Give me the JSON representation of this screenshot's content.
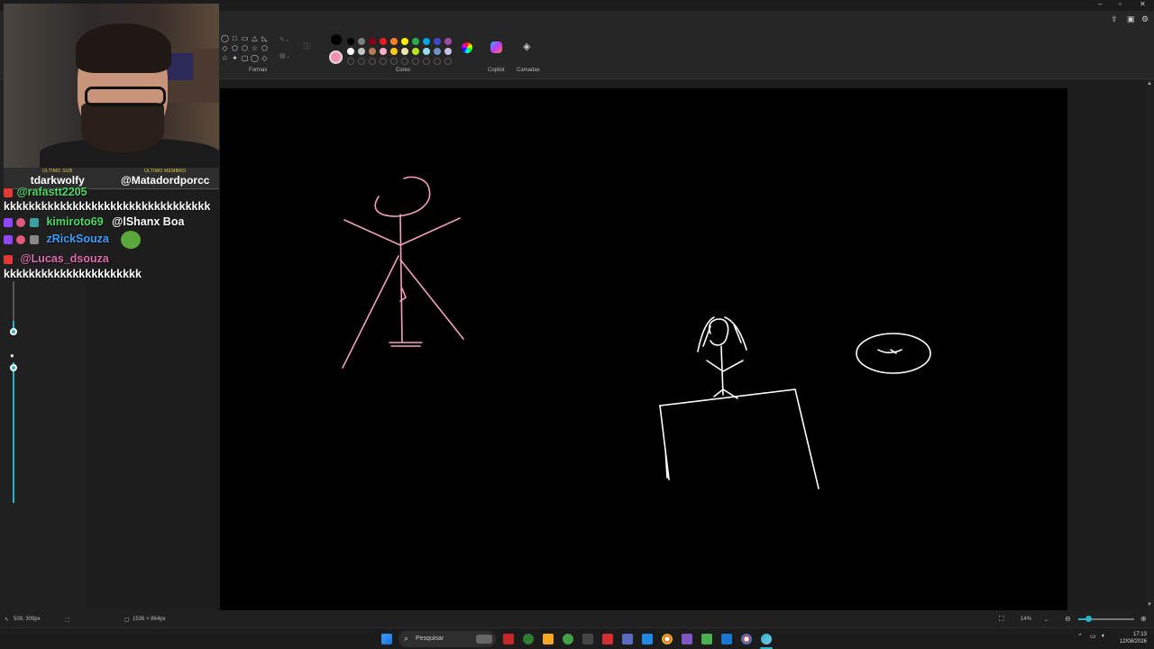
{
  "window": {
    "minimize_glyph": "–",
    "maximize_glyph": "▫",
    "close_glyph": "✕"
  },
  "ribbon": {
    "groups": {
      "shapes_label": "Formas",
      "colors_label": "Cores",
      "copilot_label": "Copilot",
      "layers_label": "Camadas"
    },
    "shape_glyphs": [
      "◯",
      "□",
      "▭",
      "△",
      "◺",
      "◇",
      "⬠",
      "⬡",
      "☆",
      "⬠",
      "☆",
      "✦",
      "▢",
      "◯",
      "◇"
    ],
    "current_color": "#f48fb1",
    "primary_color": "#000000",
    "palette_row1": [
      "#000000",
      "#7f7f7f",
      "#880015",
      "#ed1c24",
      "#ff7f27",
      "#fff200",
      "#22b14c",
      "#00a2e8",
      "#3f48cc",
      "#a349a4"
    ],
    "palette_row2": [
      "#ffffff",
      "#c3c3c3",
      "#b97a57",
      "#ffaec9",
      "#ffc90e",
      "#efe4b0",
      "#b5e61d",
      "#99d9ea",
      "#7092be",
      "#c8bfe7"
    ],
    "palette_row3_empty": 10
  },
  "webcam": {
    "left_label": "ÚLTIMO SUB",
    "left_value": "tdarkwolfy",
    "right_label": "ÚLTIMO MEMBRO",
    "right_value": "@Matadordporcc"
  },
  "chat": {
    "messages": [
      {
        "user": "@rafastt2205",
        "text": "",
        "user_color": "#4cd964"
      },
      {
        "user": "",
        "text": "kkkkkkkkkkkkkkkkkkkkkkkkkkkkkkkkk",
        "user_color": "#ffffff"
      },
      {
        "user": "kimiroto69",
        "text": "@lShanx Boa",
        "user_color": "#4cd964"
      },
      {
        "user": "zRickSouza",
        "text": "",
        "user_color": "#3aa0ff"
      },
      {
        "user": "@Lucas_dsouza",
        "text": "",
        "user_color": "#e06bb0"
      },
      {
        "user": "",
        "text": "kkkkkkkkkkkkkkkkkkkkkk",
        "user_color": "#ffffff"
      }
    ]
  },
  "status": {
    "cursor_pos": "509, 309px",
    "canvas_size": "1536 × 864px",
    "zoom": "14%"
  },
  "taskbar": {
    "search_placeholder": "Pesquisar",
    "time": "17:13",
    "date": "12/08/2026"
  },
  "colors": {
    "accent": "#2bb5c9",
    "pink_stroke": "#f4a0c0",
    "white_stroke": "#ffffff"
  }
}
